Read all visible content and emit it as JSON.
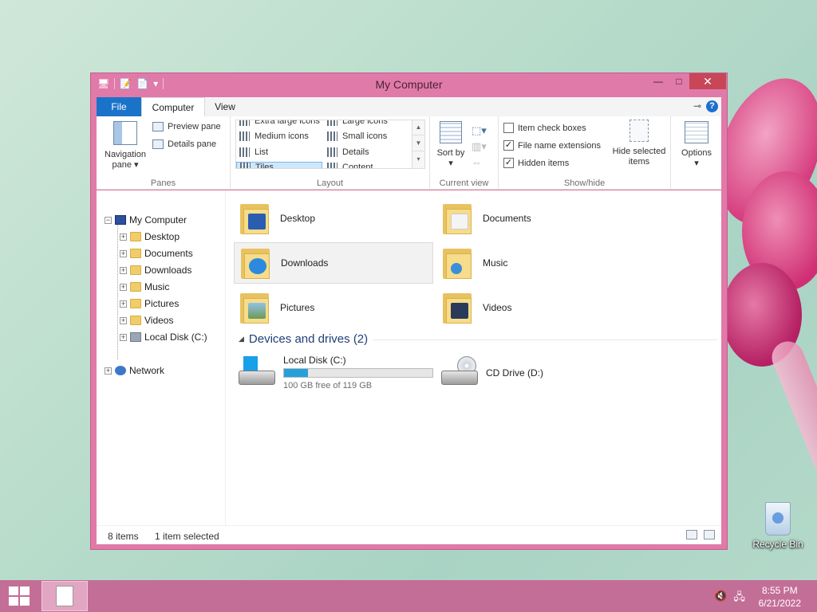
{
  "window": {
    "title": "My Computer",
    "minimize_glyph": "—",
    "maximize_glyph": "□",
    "close_glyph": "✕"
  },
  "ribbon": {
    "tabs": [
      {
        "label": "File"
      },
      {
        "label": "Computer"
      },
      {
        "label": "View"
      }
    ],
    "help_glyph": "?",
    "panes": {
      "group_label": "Panes",
      "navigation_pane": "Navigation pane",
      "preview_pane": "Preview pane",
      "details_pane": "Details pane"
    },
    "layout": {
      "group_label": "Layout",
      "items": [
        "Extra large icons",
        "Large icons",
        "Medium icons",
        "Small icons",
        "List",
        "Details",
        "Tiles",
        "Content"
      ]
    },
    "current_view": {
      "group_label": "Current view",
      "sort_by": "Sort by"
    },
    "show_hide": {
      "group_label": "Show/hide",
      "item_check_boxes": "Item check boxes",
      "item_check_boxes_checked": false,
      "file_name_extensions": "File name extensions",
      "file_name_extensions_checked": true,
      "hidden_items": "Hidden items",
      "hidden_items_checked": true,
      "hide_selected_items": "Hide selected items"
    },
    "options": "Options"
  },
  "nav_tree": {
    "root": "My Computer",
    "children": [
      "Desktop",
      "Documents",
      "Downloads",
      "Music",
      "Pictures",
      "Videos",
      "Local Disk (C:)"
    ],
    "network": "Network"
  },
  "folders": [
    {
      "label": "Desktop",
      "selected": false
    },
    {
      "label": "Documents",
      "selected": false
    },
    {
      "label": "Downloads",
      "selected": true
    },
    {
      "label": "Music",
      "selected": false
    },
    {
      "label": "Pictures",
      "selected": false
    },
    {
      "label": "Videos",
      "selected": false
    }
  ],
  "devices": {
    "header": "Devices and drives (2)",
    "drives": [
      {
        "name": "Local Disk (C:)",
        "free_text": "100 GB free of 119 GB",
        "used_fraction": 0.16
      },
      {
        "name": "CD Drive (D:)"
      }
    ]
  },
  "status": {
    "item_count": "8 items",
    "selection": "1 item selected"
  },
  "desktop": {
    "recycle_bin": "Recycle Bin"
  },
  "taskbar": {
    "time": "8:55 PM",
    "date": "6/21/2022"
  },
  "colors": {
    "window_frame": "#e07aa9",
    "file_tab": "#1a73c9",
    "taskbar": "#c36e97",
    "progress": "#26a0da"
  }
}
